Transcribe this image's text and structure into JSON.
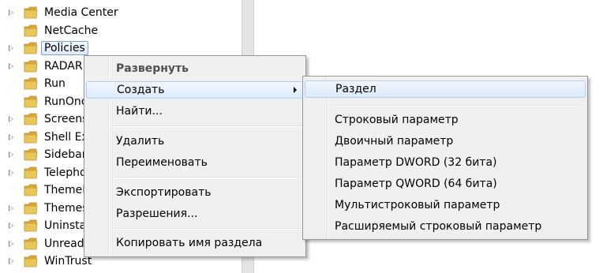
{
  "tree": {
    "items": [
      {
        "label": "Media Center",
        "expandable": true
      },
      {
        "label": "NetCache",
        "expandable": false
      },
      {
        "label": "Policies",
        "expandable": true,
        "selected": true
      },
      {
        "label": "RADAR",
        "expandable": true
      },
      {
        "label": "Run",
        "expandable": false
      },
      {
        "label": "RunOnce",
        "expandable": false
      },
      {
        "label": "Screensavers",
        "expandable": true
      },
      {
        "label": "Shell Extensions",
        "expandable": true
      },
      {
        "label": "Sidebar",
        "expandable": true
      },
      {
        "label": "Telephony",
        "expandable": true
      },
      {
        "label": "ThemeManager",
        "expandable": false
      },
      {
        "label": "Themes",
        "expandable": true
      },
      {
        "label": "Uninstall",
        "expandable": true
      },
      {
        "label": "UnreadMail",
        "expandable": true
      },
      {
        "label": "WinTrust",
        "expandable": true
      }
    ]
  },
  "context_menu": {
    "expand": "Развернуть",
    "create": "Создать",
    "find": "Найти...",
    "delete": "Удалить",
    "rename": "Переименовать",
    "export": "Экспортировать",
    "permissions": "Разрешения...",
    "copy_key_name": "Копировать имя раздела"
  },
  "submenu": {
    "key": "Раздел",
    "string_value": "Строковый параметр",
    "binary_value": "Двоичный параметр",
    "dword_value": "Параметр DWORD (32 бита)",
    "qword_value": "Параметр QWORD (64 бита)",
    "multi_string_value": "Мультистроковый параметр",
    "expandable_string_value": "Расширяемый строковый параметр"
  },
  "colors": {
    "folder": "#e8c65a",
    "selection_border": "#7da2ce",
    "hover_border": "#aecff7",
    "menu_bg": "#f0f0f0"
  }
}
